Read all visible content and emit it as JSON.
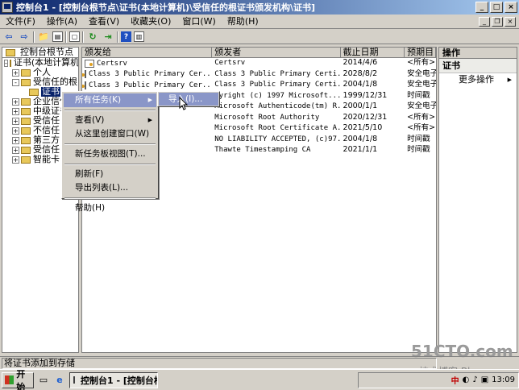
{
  "window": {
    "title": "控制台1 - [控制台根节点\\证书(本地计算机)\\受信任的根证书颁发机构\\证书]"
  },
  "menu": [
    "文件(F)",
    "操作(A)",
    "查看(V)",
    "收藏夹(O)",
    "窗口(W)",
    "帮助(H)"
  ],
  "tree": {
    "header": "控制台根节点",
    "items": [
      {
        "label": "证书(本地计算机)",
        "indent": 1,
        "expander": "-"
      },
      {
        "label": "个人",
        "indent": 2,
        "expander": "+"
      },
      {
        "label": "受信任的根",
        "indent": 2,
        "expander": "-"
      },
      {
        "label": "证书",
        "indent": 3,
        "expander": "",
        "selected": true
      },
      {
        "label": "企业信任",
        "indent": 2,
        "expander": "+"
      },
      {
        "label": "中级证书",
        "indent": 2,
        "expander": "+"
      },
      {
        "label": "受信任",
        "indent": 2,
        "expander": "+"
      },
      {
        "label": "不信任",
        "indent": 2,
        "expander": "+"
      },
      {
        "label": "第三方",
        "indent": 2,
        "expander": "+"
      },
      {
        "label": "受信任",
        "indent": 2,
        "expander": "+"
      },
      {
        "label": "智能卡",
        "indent": 2,
        "expander": "+"
      }
    ]
  },
  "list": {
    "columns": [
      "颁发给",
      "颁发者",
      "截止日期",
      "预期目"
    ],
    "rows": [
      [
        "Certsrv",
        "Certsrv",
        "2014/4/6",
        "<所有>"
      ],
      [
        "Class 3 Public Primary Cer...",
        "Class 3 Public Primary Certi...",
        "2028/8/2",
        "安全电子"
      ],
      [
        "Class 3 Public Primary Cer...",
        "Class 3 Public Primary Certi...",
        "2004/1/8",
        "安全电子"
      ],
      [
        "",
        "pyright (c) 1997 Microsoft...",
        "1999/12/31",
        "时间戳"
      ],
      [
        "",
        "Microsoft Authenticode(tm) R...",
        "2000/1/1",
        "安全电子"
      ],
      [
        "uthority",
        "Microsoft Root Authority",
        "2020/12/31",
        "<所有>"
      ],
      [
        "ertificate...",
        "Microsoft Root Certificate A...",
        "2021/5/10",
        "<所有>"
      ],
      [
        "EPTED, (c)...",
        "NO LIABILITY ACCEPTED, (c)97...",
        "2004/1/8",
        "时间戳"
      ],
      [
        "ng CA",
        "Thawte Timestamping CA",
        "2021/1/1",
        "时间戳"
      ]
    ]
  },
  "actions": {
    "header": "操作",
    "section": "证书",
    "more": "更多操作"
  },
  "context_menu": {
    "items": [
      {
        "label": "所有任务(K)",
        "submenu": true,
        "highlighted": true
      },
      {
        "sep": true
      },
      {
        "label": "查看(V)",
        "submenu": true
      },
      {
        "label": "从这里创建窗口(W)"
      },
      {
        "sep": true
      },
      {
        "label": "新任务板视图(T)..."
      },
      {
        "sep": true
      },
      {
        "label": "刷新(F)"
      },
      {
        "label": "导出列表(L)..."
      },
      {
        "sep": true
      },
      {
        "label": "帮助(H)"
      }
    ],
    "submenu_item": "导入(I)..."
  },
  "status": "将证书添加到存储",
  "taskbar": {
    "start": "开始",
    "task": "控制台1 - [控制台根...",
    "ime": "中",
    "clock": "13:09"
  },
  "watermark": {
    "site": "51CTO.com",
    "sub": "技术博客  Blog"
  }
}
